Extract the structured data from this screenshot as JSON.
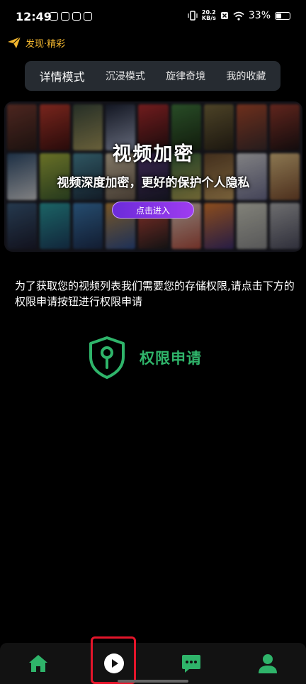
{
  "status_bar": {
    "time": "12:49",
    "net_speed_value": "20.2",
    "net_speed_unit": "KB/s",
    "battery_percent": "33%",
    "battery_level": 0.33
  },
  "header": {
    "discover_label": "发现·精彩",
    "accent_color": "#F2B62F"
  },
  "tabs": [
    {
      "label": "详情模式",
      "active": true
    },
    {
      "label": "沉浸模式",
      "active": false
    },
    {
      "label": "旋律奇境",
      "active": false
    },
    {
      "label": "我的收藏",
      "active": false
    }
  ],
  "banner": {
    "title": "视频加密",
    "subtitle": "视频深度加密，更好的保护个人隐私",
    "button_label": "点击进入",
    "button_color": "#8A35E8"
  },
  "permission": {
    "message": "为了获取您的视频列表我们需要您的存储权限,请点击下方的权限申请按钮进行权限申请",
    "button_label": "权限申请",
    "accent_color": "#2FB46A"
  },
  "bottom_nav": {
    "items": [
      {
        "icon": "home-icon",
        "active": false
      },
      {
        "icon": "play-icon",
        "active": true
      },
      {
        "icon": "chat-icon",
        "active": false
      },
      {
        "icon": "user-icon",
        "active": false
      }
    ],
    "active_color": "#2FB46A",
    "highlight_color": "#E4152A"
  }
}
